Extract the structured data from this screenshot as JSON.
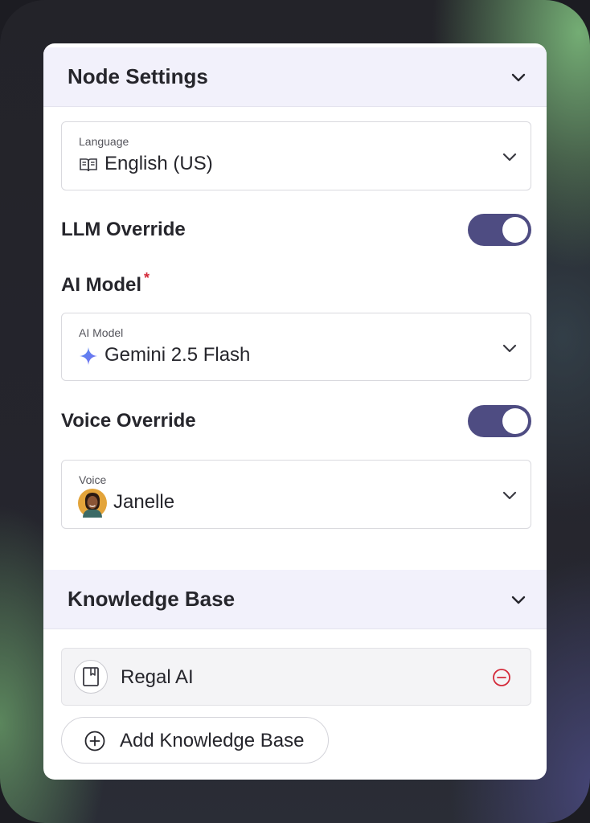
{
  "node_settings": {
    "title": "Node Settings",
    "language": {
      "label": "Language",
      "value": "English (US)"
    },
    "llm_override": {
      "label": "LLM Override",
      "enabled": true
    },
    "ai_model_section": {
      "label": "AI Model",
      "required_marker": "*"
    },
    "ai_model": {
      "label": "AI Model",
      "value": "Gemini 2.5 Flash"
    },
    "voice_override": {
      "label": "Voice Override",
      "enabled": true
    },
    "voice": {
      "label": "Voice",
      "value": "Janelle"
    }
  },
  "knowledge_base": {
    "title": "Knowledge Base",
    "items": [
      {
        "name": "Regal AI"
      }
    ],
    "add_label": "Add Knowledge Base"
  },
  "colors": {
    "toggle_on": "#4e4c82",
    "header_bg": "#f2f1fb",
    "remove_red": "#d42a3a"
  }
}
